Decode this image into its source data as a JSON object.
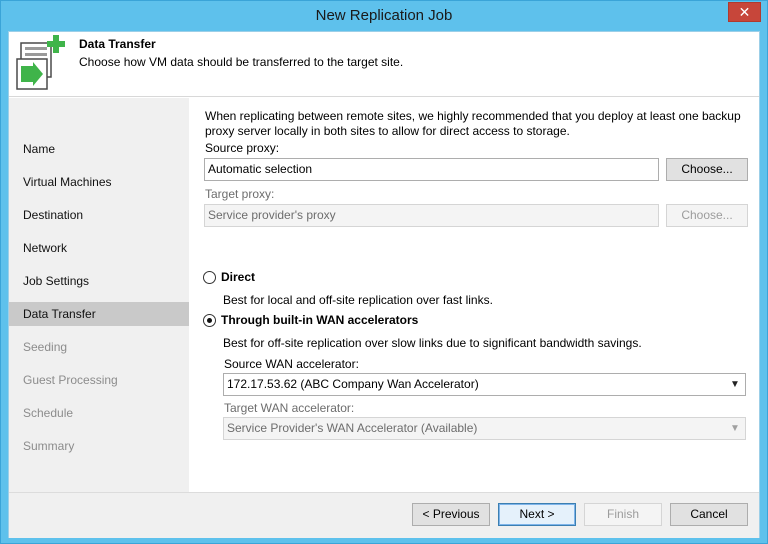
{
  "window": {
    "title": "New Replication Job",
    "close_glyph": "✕"
  },
  "header": {
    "icon": "replication-wizard-icon",
    "title": "Data Transfer",
    "subtitle": "Choose how VM data should be transferred to the target site."
  },
  "sidebar": {
    "steps": [
      {
        "label": "Name"
      },
      {
        "label": "Virtual Machines"
      },
      {
        "label": "Destination"
      },
      {
        "label": "Network"
      },
      {
        "label": "Job Settings"
      },
      {
        "label": "Data Transfer"
      },
      {
        "label": "Seeding"
      },
      {
        "label": "Guest Processing"
      },
      {
        "label": "Schedule"
      },
      {
        "label": "Summary"
      }
    ],
    "active_step": "Data Transfer"
  },
  "main": {
    "info": "When replicating between remote sites, we highly recommended that you deploy at least one backup proxy server locally in both sites to allow for direct access to storage.",
    "source_proxy": {
      "label": "Source proxy:",
      "value": "Automatic selection",
      "button": "Choose..."
    },
    "target_proxy": {
      "label": "Target proxy:",
      "placeholder": "Service provider's proxy",
      "button": "Choose..."
    },
    "direct": {
      "label": "Direct",
      "description": "Best for local and off-site replication over fast links.",
      "selected": false
    },
    "wan": {
      "label": "Through built-in WAN accelerators",
      "description": "Best for off-site replication over slow links due to significant bandwidth savings.",
      "selected": true,
      "source_label": "Source WAN accelerator:",
      "source_value": "172.17.53.62 (ABC Company Wan Accelerator)",
      "target_label": "Target WAN accelerator:",
      "target_value": "Service Provider's WAN Accelerator (Available)"
    }
  },
  "footer": {
    "previous": "< Previous",
    "next": "Next >",
    "finish": "Finish",
    "cancel": "Cancel"
  },
  "colors": {
    "window_frame": "#5ec1ec",
    "close_button": "#c7463a",
    "active_step_bg": "#c9c9c9",
    "icon_green": "#3fb44a"
  }
}
